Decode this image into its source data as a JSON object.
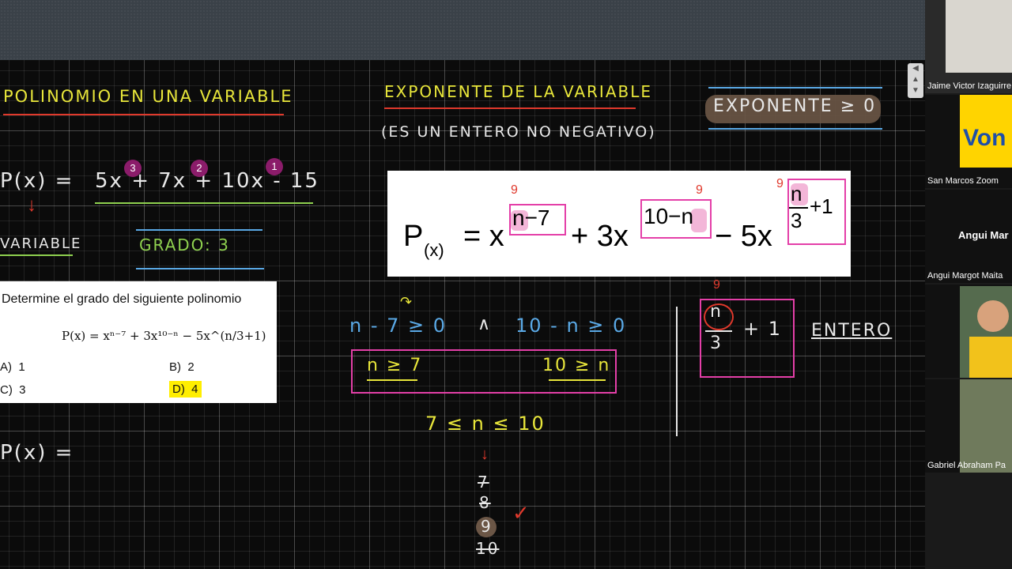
{
  "board": {
    "title_left": "POLINOMIO EN UNA VARIABLE",
    "title_center": "EXPONENTE DE LA VARIABLE",
    "subtitle_center": "(ES UN ENTERO NO NEGATIVO)",
    "exponent_rule": "EXPONENTE ≥ 0",
    "poly_lhs": "P(x) =",
    "poly_rhs": "5x + 7x + 10x - 15",
    "exp_marks": [
      "3",
      "2",
      "1"
    ],
    "variable_label": "VARIABLE",
    "grado_label": "GRADO: 3",
    "bottom_px": "P(x) =",
    "condition_1": "n - 7 ≥ 0",
    "and_symbol": "∧",
    "condition_2": "10 - n ≥ 0",
    "result_1": "n ≥ 7",
    "result_2": "10 ≥ n",
    "range": "7 ≤ n ≤ 10",
    "candidates": [
      "7",
      "8",
      "9",
      "10"
    ],
    "fraction_num": "n",
    "fraction_den": "3",
    "fraction_plus": "+ 1",
    "entero": "ENTERO",
    "nine_mark": "9"
  },
  "formula_panel": {
    "lhs": "P",
    "lhs_sub": "(x)",
    "eq": "= x",
    "exp1": "n−7",
    "term2": "+ 3x",
    "exp2": "10−n",
    "term3": "− 5x",
    "exp3_num": "n",
    "exp3_den": "3",
    "exp3_plus": "+1"
  },
  "question_card": {
    "question": "Determine el grado del siguiente polinomio",
    "formula_text": "P(x) = xⁿ⁻⁷ + 3x¹⁰⁻ⁿ − 5x^(n/3+1)",
    "options": [
      {
        "letter": "A)",
        "value": "1"
      },
      {
        "letter": "B)",
        "value": "2"
      },
      {
        "letter": "C)",
        "value": "3"
      },
      {
        "letter": "D)",
        "value": "4"
      }
    ],
    "highlight_color": "#ffee00"
  },
  "participants": [
    {
      "name": "Jaime Victor Izaguirre"
    },
    {
      "name": "San Marcos Zoom",
      "logo": "Von"
    },
    {
      "name": "Angui Margot Maita",
      "display": "Angui Mar"
    },
    {
      "name": ""
    },
    {
      "name": "Gabriel Abraham Pa"
    }
  ],
  "colors": {
    "accent_pink": "#e43fa8",
    "chalk_yellow": "#e8e63a",
    "chalk_green": "#8fd14f",
    "chalk_blue": "#5aa9e6",
    "red_line": "#e0392c"
  }
}
